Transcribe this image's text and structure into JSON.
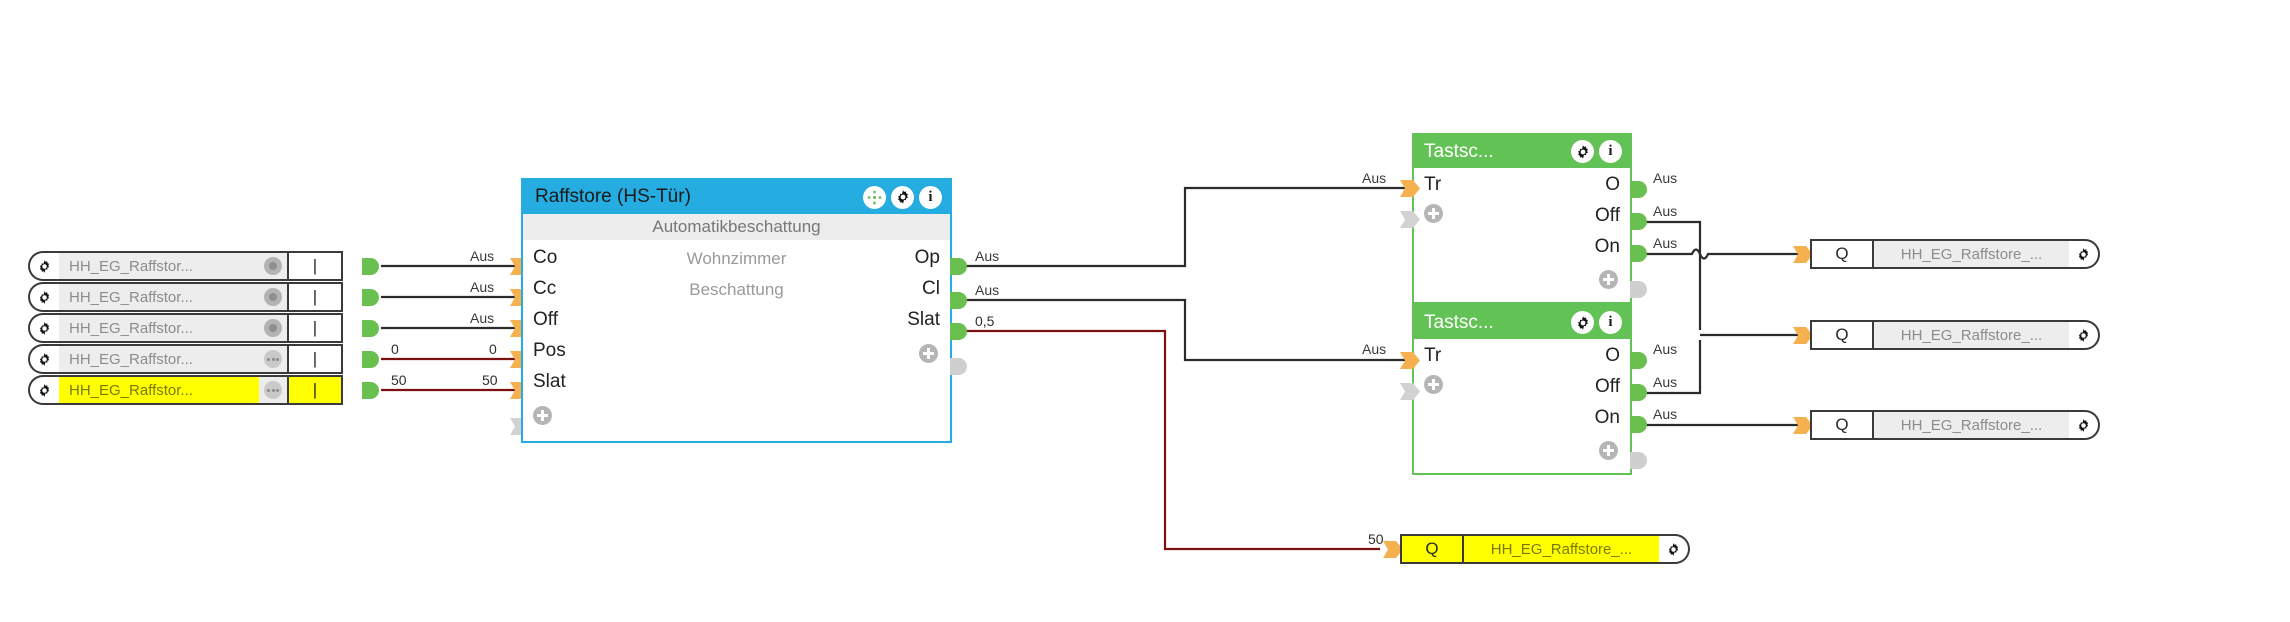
{
  "canvas": {
    "background": "#ffffff",
    "accent_blue": "#25ace0",
    "accent_green": "#63c255",
    "highlight_yellow": "#ffff00",
    "pin_green": "#6ac04f",
    "pin_orange": "#f5b14f",
    "wire_black": "#2b2b2b",
    "wire_red": "#7a1010"
  },
  "inputs": {
    "nodes": [
      {
        "label": "HH_EG_Raffstor...",
        "state_icon": "radio-dot-icon",
        "value": "|",
        "highlighted": false,
        "out_label": "Aus",
        "wire_color": "black"
      },
      {
        "label": "HH_EG_Raffstor...",
        "state_icon": "radio-dot-icon",
        "value": "|",
        "highlighted": false,
        "out_label": "Aus",
        "wire_color": "black"
      },
      {
        "label": "HH_EG_Raffstor...",
        "state_icon": "radio-dot-icon",
        "value": "|",
        "highlighted": false,
        "out_label": "Aus",
        "wire_color": "black"
      },
      {
        "label": "HH_EG_Raffstor...",
        "state_icon": "ellipsis-icon",
        "value": "|",
        "highlighted": false,
        "out_label": "0",
        "wire_color": "red"
      },
      {
        "label": "HH_EG_Raffstor...",
        "state_icon": "ellipsis-icon",
        "value": "|",
        "highlighted": true,
        "out_label": "50",
        "wire_color": "red"
      }
    ]
  },
  "raffstore": {
    "title": "Raffstore (HS-Tür)",
    "subtitle": "Automatikbeschattung",
    "center_lines": [
      "Wohnzimmer",
      "Beschattung"
    ],
    "inputs": [
      "Co",
      "Cc",
      "Off",
      "Pos",
      "Slat"
    ],
    "outputs": [
      "Op",
      "Cl",
      "Slat"
    ],
    "input_wire_labels": [
      "Aus",
      "Aus",
      "Aus",
      "0",
      "50"
    ],
    "output_wire_labels": [
      "Aus",
      "Aus",
      "0,5"
    ],
    "header_icons": [
      "move-icon",
      "gear-icon",
      "info-icon"
    ]
  },
  "tastsc": [
    {
      "title": "Tastsc...",
      "inputs": [
        "Tr"
      ],
      "outputs": [
        "O",
        "Off",
        "On"
      ],
      "input_wire_labels": [
        "Aus"
      ],
      "output_wire_labels": [
        "Aus",
        "Aus",
        "Aus"
      ],
      "header_icons": [
        "gear-icon",
        "info-icon"
      ]
    },
    {
      "title": "Tastsc...",
      "inputs": [
        "Tr"
      ],
      "outputs": [
        "O",
        "Off",
        "On"
      ],
      "input_wire_labels": [
        "Aus"
      ],
      "output_wire_labels": [
        "Aus",
        "Aus",
        "Aus"
      ],
      "header_icons": [
        "gear-icon",
        "info-icon"
      ]
    }
  ],
  "outputs": {
    "nodes": [
      {
        "port": "Q",
        "label": "HH_EG_Raffstore_...",
        "highlighted": false
      },
      {
        "port": "Q",
        "label": "HH_EG_Raffstore_...",
        "highlighted": false
      },
      {
        "port": "Q",
        "label": "HH_EG_Raffstore_...",
        "highlighted": false
      },
      {
        "port": "Q",
        "label": "HH_EG_Raffstore_...",
        "highlighted": true,
        "in_wire_label": "50"
      }
    ]
  }
}
